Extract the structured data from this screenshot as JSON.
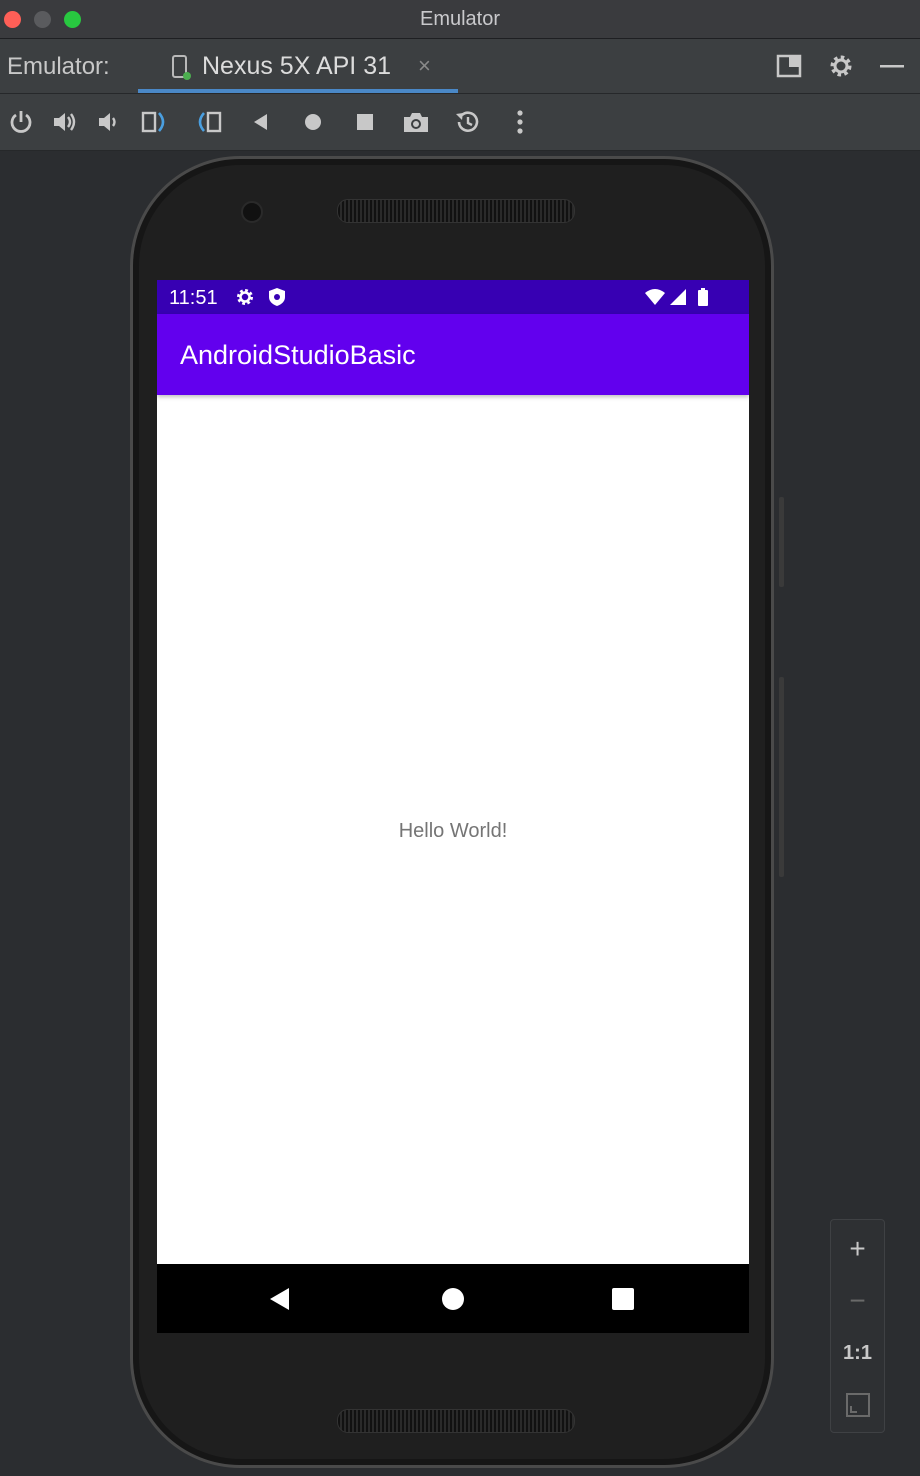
{
  "window": {
    "title": "Emulator"
  },
  "tool_window": {
    "label": "Emulator:",
    "tab": {
      "label": "Nexus 5X API 31",
      "close_glyph": "×"
    }
  },
  "toolbar": {
    "icons": [
      "power-icon",
      "volume-up-icon",
      "volume-down-icon",
      "rotate-left-icon",
      "rotate-right-icon",
      "back-icon",
      "home-icon",
      "overview-icon",
      "screenshot-icon",
      "snapshot-icon",
      "more-options-icon"
    ]
  },
  "device": {
    "status_bar": {
      "time": "11:51"
    },
    "app_bar": {
      "title": "AndroidStudioBasic"
    },
    "content": {
      "text": "Hello World!"
    }
  },
  "zoom_panel": {
    "zoom_in": "+",
    "zoom_out": "−",
    "actual_size": "1:1"
  },
  "colors": {
    "status_bar": "#3700b3",
    "app_bar": "#6200ee",
    "tab_underline": "#4a88c7",
    "ide_background": "#2b2d30"
  }
}
